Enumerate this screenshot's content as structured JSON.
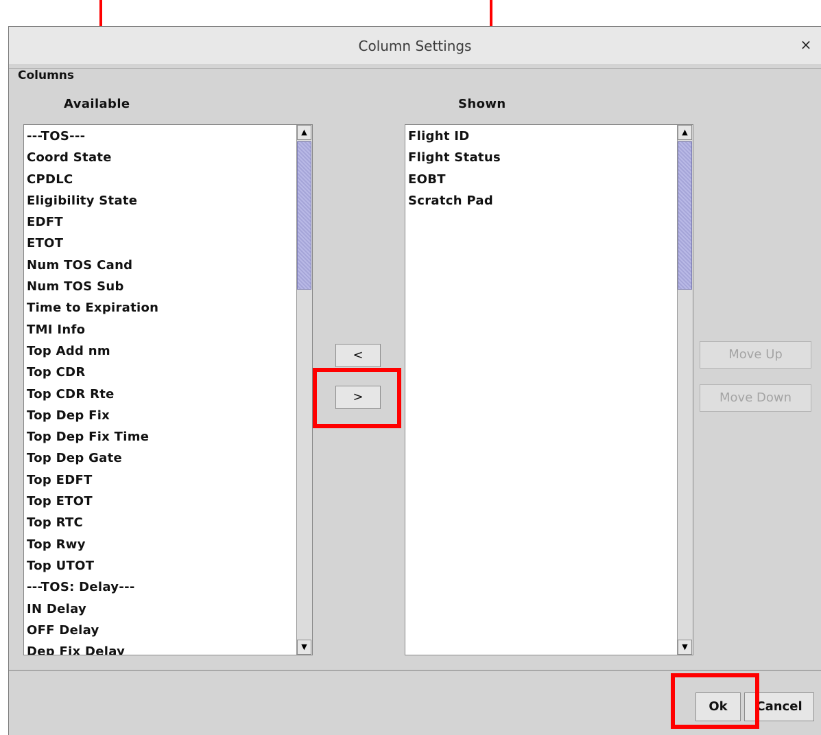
{
  "window": {
    "title": "Column Settings",
    "close_label": "×"
  },
  "group": {
    "legend": "Columns"
  },
  "available": {
    "heading": "Available",
    "items": [
      "---TOS---",
      "Coord State",
      "CPDLC",
      "Eligibility State",
      "EDFT",
      "ETOT",
      "Num TOS Cand",
      "Num TOS Sub",
      "Time to Expiration",
      "TMI Info",
      "Top Add nm",
      "Top CDR",
      "Top CDR Rte",
      "Top Dep Fix",
      "Top Dep Fix Time",
      "Top Dep Gate",
      "Top EDFT",
      "Top ETOT",
      "Top RTC",
      "Top Rwy",
      "Top UTOT",
      "---TOS: Delay---",
      "IN Delay",
      "OFF Delay",
      "Dep Fix Delay"
    ]
  },
  "shown": {
    "heading": "Shown",
    "items": [
      "Flight ID",
      "Flight Status",
      "EOBT",
      "Scratch Pad"
    ]
  },
  "transfer": {
    "remove_label": "<",
    "add_label": ">"
  },
  "order": {
    "move_up_label": "Move Up",
    "move_down_label": "Move Down"
  },
  "footer": {
    "ok_label": "Ok",
    "cancel_label": "Cancel"
  },
  "scroll_icons": {
    "up": "▲",
    "down": "▼"
  },
  "colors": {
    "annotation": "#ff0000",
    "thumb": "#b9b9e6"
  }
}
